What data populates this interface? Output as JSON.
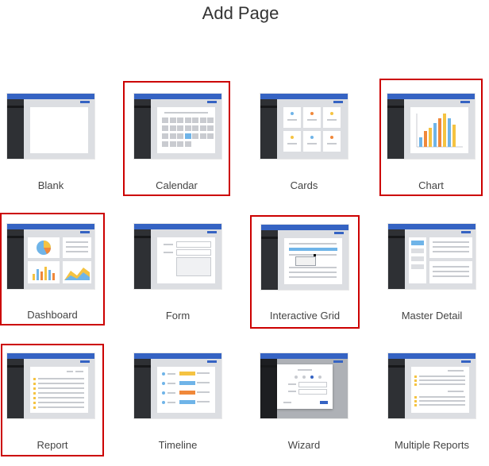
{
  "page": {
    "title": "Add Page"
  },
  "tiles": [
    {
      "id": "blank",
      "label": "Blank",
      "icon": "blank-page-icon",
      "selected": false
    },
    {
      "id": "calendar",
      "label": "Calendar",
      "icon": "calendar-page-icon",
      "selected": true
    },
    {
      "id": "cards",
      "label": "Cards",
      "icon": "cards-page-icon",
      "selected": false
    },
    {
      "id": "chart",
      "label": "Chart",
      "icon": "chart-page-icon",
      "selected": true
    },
    {
      "id": "dashboard",
      "label": "Dashboard",
      "icon": "dashboard-page-icon",
      "selected": true
    },
    {
      "id": "form",
      "label": "Form",
      "icon": "form-page-icon",
      "selected": false
    },
    {
      "id": "interactive-grid",
      "label": "Interactive Grid",
      "icon": "interactive-grid-page-icon",
      "selected": true
    },
    {
      "id": "master-detail",
      "label": "Master Detail",
      "icon": "master-detail-page-icon",
      "selected": false
    },
    {
      "id": "report",
      "label": "Report",
      "icon": "report-page-icon",
      "selected": true
    },
    {
      "id": "timeline",
      "label": "Timeline",
      "icon": "timeline-page-icon",
      "selected": false
    },
    {
      "id": "wizard",
      "label": "Wizard",
      "icon": "wizard-page-icon",
      "selected": false
    },
    {
      "id": "multiple-reports",
      "label": "Multiple Reports",
      "icon": "multiple-reports-page-icon",
      "selected": false
    }
  ],
  "colors": {
    "header_blue": "#3563c3",
    "sidebar_dark": "#2e3034",
    "selection_red": "#cc0000",
    "accent_yellow": "#f5c342",
    "accent_orange": "#f0883a",
    "accent_light_blue": "#6fb4e8"
  }
}
